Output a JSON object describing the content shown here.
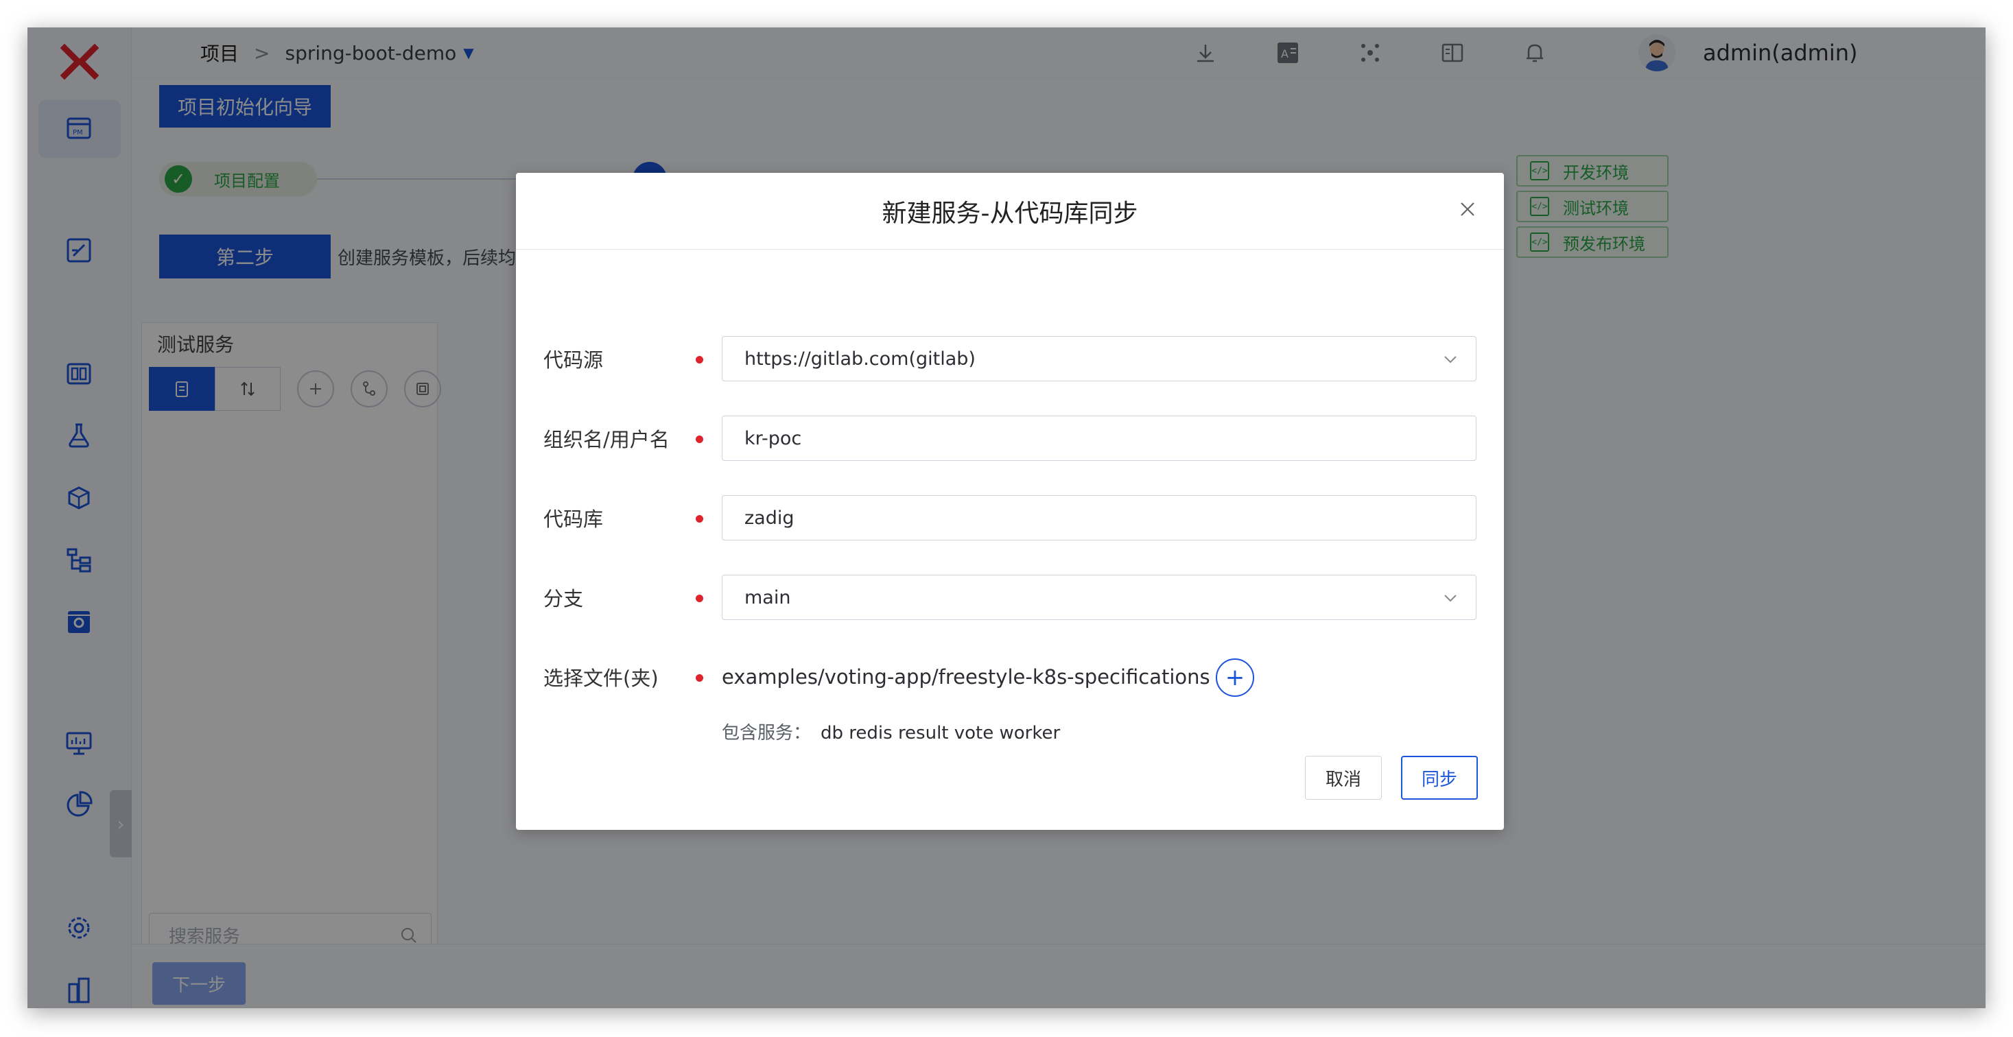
{
  "header": {
    "breadcrumb_root": "项目",
    "breadcrumb_sep": ">",
    "project_name": "spring-boot-demo",
    "user": "admin(admin)"
  },
  "wizard": {
    "button_label": "项目初始化向导",
    "step1_label": "项目配置",
    "step2_button": "第二步",
    "step2_desc": "创建服务模板，后续均"
  },
  "environments": [
    "开发环境",
    "测试环境",
    "预发布环境"
  ],
  "env_icon_text": "</>",
  "service_panel": {
    "title": "测试服务",
    "search_placeholder": "搜索服务"
  },
  "bottom": {
    "next_label": "下一步"
  },
  "modal": {
    "title": "新建服务-从代码库同步",
    "fields": {
      "source_label": "代码源",
      "source_value": "https://gitlab.com(gitlab)",
      "org_label": "组织名/用户名",
      "org_value": "kr-poc",
      "repo_label": "代码库",
      "repo_value": "zadig",
      "branch_label": "分支",
      "branch_value": "main",
      "path_label": "选择文件(夹)",
      "path_value": "examples/voting-app/freestyle-k8s-specifications"
    },
    "contains_label": "包含服务：",
    "contains_services": "db redis result vote worker",
    "cancel_label": "取消",
    "sync_label": "同步"
  },
  "colors": {
    "brand_blue": "#1b55d9",
    "success_green": "#2aa847",
    "required_red": "#e0242e",
    "logo_red": "#e0242e"
  },
  "icons": {
    "sidebar": [
      "project-icon",
      "edit-icon",
      "dashboard-icon",
      "test-flask-icon",
      "packages-icon",
      "workflow-icon",
      "settings-box-icon",
      "monitor-icon",
      "pie-chart-icon",
      "gear-icon",
      "building-icon"
    ],
    "header": [
      "download-icon",
      "translate-icon",
      "cluster-icon",
      "book-icon",
      "bell-icon"
    ]
  }
}
